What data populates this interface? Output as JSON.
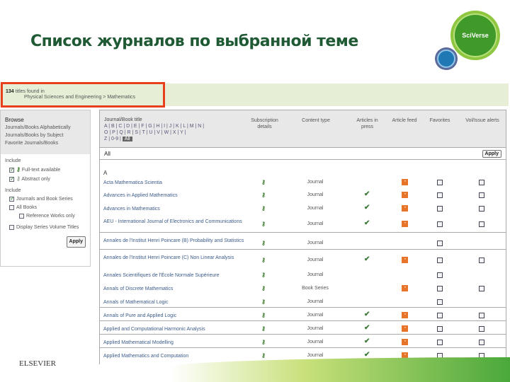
{
  "slide_title": "Список журналов по выбранной теме",
  "logo_text": "SciVerse",
  "publisher_logo": "ELSEVIER",
  "results": {
    "count": "134",
    "suffix": "titles found in",
    "path": "Physical Sciences and Engineering > Mathematics"
  },
  "browse": {
    "heading": "Browse",
    "links": [
      "Journals/Books Alphabetically",
      "Journals/Books by Subject",
      "Favorite Journals/Books"
    ]
  },
  "include1": {
    "heading": "Include",
    "items": [
      {
        "label": "Full-text available",
        "checked": true
      },
      {
        "label": "Abstract only",
        "checked": true
      }
    ]
  },
  "include2": {
    "heading": "Include",
    "items": [
      {
        "label": "Journals and Book Series",
        "checked": true
      },
      {
        "label": "All Books",
        "checked": false
      },
      {
        "label": "Reference Works only",
        "checked": false
      },
      {
        "label": "Display Series Volume Titles",
        "checked": false
      }
    ]
  },
  "apply_label": "Apply",
  "table": {
    "headers": {
      "title": "Journal/Book title",
      "subscription": "Subscription details",
      "content_type": "Content type",
      "in_press": "Articles in press",
      "feed": "Article feed",
      "favorites": "Favorites",
      "alerts": "Vol/Issue alerts"
    },
    "letters_line1": "A | B | C | D | E | F | G | H | I | J | K | L | M | N |",
    "letters_line2": "O | P | Q | R | S | T | U | V | W | X | Y |",
    "letters_line3": "Z | 0-9 |",
    "letter_selected": "All",
    "filter_label": "All",
    "section": "A",
    "rows": [
      {
        "title": "Acta Mathematica Scientia",
        "type": "Journal",
        "in_press": false,
        "feed": true,
        "fav": true,
        "alert": true
      },
      {
        "title": "Advances in Applied Mathematics",
        "type": "Journal",
        "in_press": true,
        "feed": true,
        "fav": true,
        "alert": true
      },
      {
        "title": "Advances in Mathematics",
        "type": "Journal",
        "in_press": true,
        "feed": true,
        "fav": true,
        "alert": true
      },
      {
        "title": "AEU - International Journal of Electronics and Communications",
        "type": "Journal",
        "in_press": true,
        "feed": true,
        "fav": true,
        "alert": true
      },
      {
        "title": "Annales de l'Institut Henri Poincare (B) Probability and Statistics",
        "type": "Journal",
        "in_press": false,
        "feed": false,
        "fav": true,
        "alert": false
      },
      {
        "title": "Annales de l'Institut Henri Poincare (C) Non Linear Analysis",
        "type": "Journal",
        "in_press": true,
        "feed": true,
        "fav": true,
        "alert": true
      },
      {
        "title": "Annales Scientifiques de l'École Normale Supérieure",
        "type": "Journal",
        "in_press": false,
        "feed": false,
        "fav": true,
        "alert": false
      },
      {
        "title": "Annals of Discrete Mathematics",
        "type": "Book Series",
        "in_press": false,
        "feed": true,
        "fav": true,
        "alert": true
      },
      {
        "title": "Annals of Mathematical Logic",
        "type": "Journal",
        "in_press": false,
        "feed": false,
        "fav": true,
        "alert": false
      },
      {
        "title": "Annals of Pure and Applied Logic",
        "type": "Journal",
        "in_press": true,
        "feed": true,
        "fav": true,
        "alert": true
      },
      {
        "title": "Applied and Computational Harmonic Analysis",
        "type": "Journal",
        "in_press": true,
        "feed": true,
        "fav": true,
        "alert": true
      },
      {
        "title": "Applied Mathematical Modelling",
        "type": "Journal",
        "in_press": true,
        "feed": true,
        "fav": true,
        "alert": true
      },
      {
        "title": "Applied Mathematics and Computation",
        "type": "Journal",
        "in_press": true,
        "feed": true,
        "fav": true,
        "alert": true
      }
    ]
  },
  "colors": {
    "title": "#1f5a35",
    "highlight": "#e8401c",
    "feed": "#e8742a",
    "check": "#3f7a3a"
  }
}
